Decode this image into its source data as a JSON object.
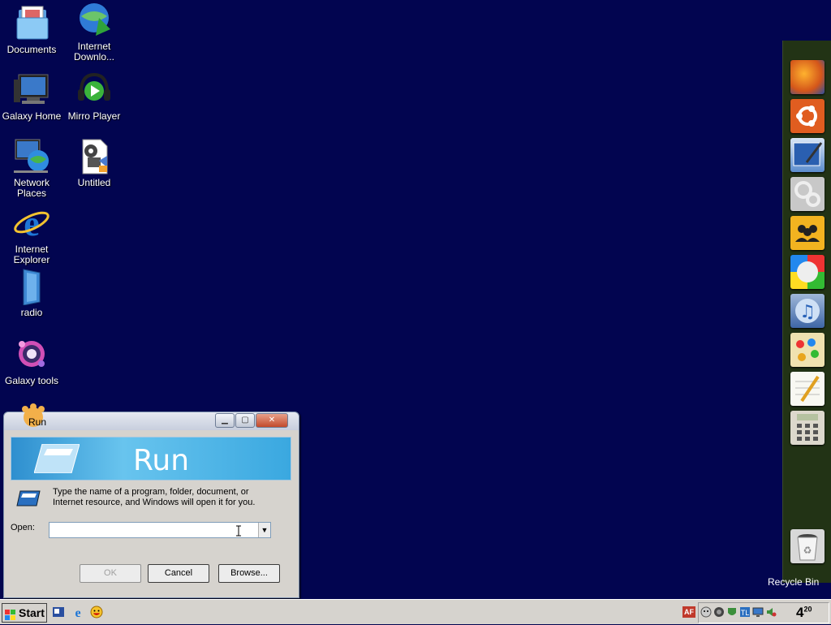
{
  "desktop_icons": [
    {
      "label": "Documents",
      "icon": "documents-folder-icon"
    },
    {
      "label": "Internet Downlo...",
      "icon": "internet-download-manager-icon"
    },
    {
      "label": "Galaxy Home",
      "icon": "computer-icon"
    },
    {
      "label": "Mirro Player",
      "icon": "media-player-icon"
    },
    {
      "label": "Network Places",
      "icon": "network-places-icon"
    },
    {
      "label": "Untitled",
      "icon": "video-file-icon"
    },
    {
      "label": "Internet Explorer",
      "icon": "internet-explorer-icon"
    },
    {
      "label": "radio",
      "icon": "radio-icon"
    },
    {
      "label": "Galaxy tools",
      "icon": "galaxy-tools-icon"
    }
  ],
  "dock": {
    "items": [
      "firefox-icon",
      "ubuntu-icon",
      "screen-editor-icon",
      "gears-icon",
      "people-icon",
      "color-orb-icon",
      "itunes-icon",
      "paint-icon",
      "notepad-icon",
      "calculator-icon"
    ],
    "trash": "recycle-bin-icon",
    "trash_label": "Recycle Bin"
  },
  "run_dialog": {
    "title": "Run",
    "banner_title": "Run",
    "description": "Type the name of a program, folder, document, or Internet resource, and Windows will open it for you.",
    "open_label": "Open:",
    "open_value": "",
    "ok_label": "OK",
    "cancel_label": "Cancel",
    "browse_label": "Browse...",
    "minimize": "minimize-icon",
    "maximize": "maximize-icon",
    "close": "close-icon"
  },
  "taskbar": {
    "start_label": "Start",
    "quick_launch": [
      "show-desktop-icon",
      "internet-explorer-icon",
      "messenger-icon"
    ],
    "tray_icons": [
      "af-icon",
      "yahoo-icon",
      "network-icon",
      "shield-icon",
      "tl-icon",
      "monitor-icon",
      "volume-icon"
    ],
    "tray_af": "AF",
    "clock_hour": "4",
    "clock_min": "20"
  }
}
